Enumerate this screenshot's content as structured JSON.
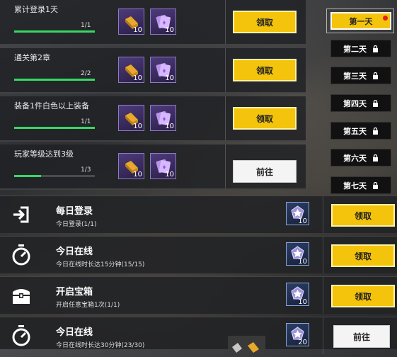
{
  "quests": [
    {
      "title": "累计登录1天",
      "progress": "1/1",
      "fill": 1.0,
      "items": [
        {
          "icon": "gold-ingot-icon",
          "qty": "10"
        },
        {
          "icon": "purple-card-icon",
          "qty": "10"
        }
      ],
      "button": "领取",
      "button_style": "yellow"
    },
    {
      "title": "通关第2章",
      "progress": "2/2",
      "fill": 1.0,
      "items": [
        {
          "icon": "gold-ingot-icon",
          "qty": "10"
        },
        {
          "icon": "purple-card-icon",
          "qty": "10"
        }
      ],
      "button": "领取",
      "button_style": "yellow"
    },
    {
      "title": "装备1件白色以上装备",
      "progress": "1/1",
      "fill": 1.0,
      "items": [
        {
          "icon": "gold-ingot-icon",
          "qty": "10"
        },
        {
          "icon": "purple-card-icon",
          "qty": "10"
        }
      ],
      "button": "领取",
      "button_style": "yellow"
    },
    {
      "title": "玩家等级达到3级",
      "progress": "1/3",
      "fill": 0.33,
      "items": [
        {
          "icon": "gold-ingot-icon",
          "qty": "10"
        },
        {
          "icon": "purple-card-icon",
          "qty": "10"
        }
      ],
      "button": "前往",
      "button_style": "white"
    }
  ],
  "days": [
    {
      "label": "第一天",
      "active": true,
      "locked": false,
      "badge": true
    },
    {
      "label": "第二天",
      "active": false,
      "locked": true
    },
    {
      "label": "第三天",
      "active": false,
      "locked": true
    },
    {
      "label": "第四天",
      "active": false,
      "locked": true
    },
    {
      "label": "第五天",
      "active": false,
      "locked": true
    },
    {
      "label": "第六天",
      "active": false,
      "locked": true
    },
    {
      "label": "第七天",
      "active": false,
      "locked": true
    }
  ],
  "daily": [
    {
      "icon": "login-icon",
      "title": "每日登录",
      "sub": "今日登录(1/1)",
      "reward_icon": "blue-crystal-icon",
      "reward_qty": "10",
      "button": "领取",
      "button_style": "yellow"
    },
    {
      "icon": "stopwatch-icon",
      "title": "今日在线",
      "sub": "今日在线时长达15分钟(15/15)",
      "reward_icon": "blue-crystal-icon",
      "reward_qty": "10",
      "button": "领取",
      "button_style": "yellow"
    },
    {
      "icon": "treasure-chest-icon",
      "title": "开启宝箱",
      "sub": "开启任意宝箱1次(1/1)",
      "reward_icon": "blue-crystal-icon",
      "reward_qty": "10",
      "button": "领取",
      "button_style": "yellow"
    },
    {
      "icon": "stopwatch-icon",
      "title": "今日在线",
      "sub": "今日在线时长达30分钟(23/30)",
      "reward_icon": "blue-crystal-icon",
      "reward_qty": "20",
      "button": "前往",
      "button_style": "white"
    }
  ],
  "colors": {
    "accent_yellow": "#f4c40c",
    "progress_green": "#37d864",
    "alert_red": "#e02020"
  }
}
